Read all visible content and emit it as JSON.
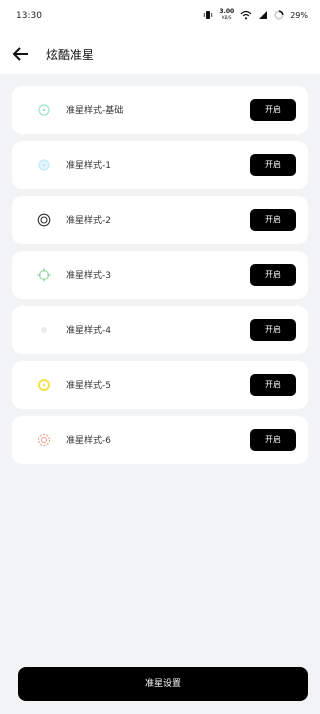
{
  "status": {
    "time": "13:30",
    "speed_value": "3.00",
    "speed_unit": "KB/S",
    "battery": "29%"
  },
  "header": {
    "title": "炫酷准星"
  },
  "items": [
    {
      "label": "准星样式-基础",
      "button": "开启",
      "icon": "crosshair-basic-icon",
      "color": "#9fe3cf"
    },
    {
      "label": "准星样式-1",
      "button": "开启",
      "icon": "crosshair-1-icon",
      "color": "#bfe8f2"
    },
    {
      "label": "准星样式-2",
      "button": "开启",
      "icon": "crosshair-2-icon",
      "color": "#333333"
    },
    {
      "label": "准星样式-3",
      "button": "开启",
      "icon": "crosshair-3-icon",
      "color": "#8fd19a"
    },
    {
      "label": "准星样式-4",
      "button": "开启",
      "icon": "crosshair-4-icon",
      "color": "#e6e6e6"
    },
    {
      "label": "准星样式-5",
      "button": "开启",
      "icon": "crosshair-5-icon",
      "color": "#f2e24a"
    },
    {
      "label": "准星样式-6",
      "button": "开启",
      "icon": "crosshair-6-icon",
      "color": "#e89a8a"
    }
  ],
  "footer": {
    "settings_label": "准星设置"
  }
}
